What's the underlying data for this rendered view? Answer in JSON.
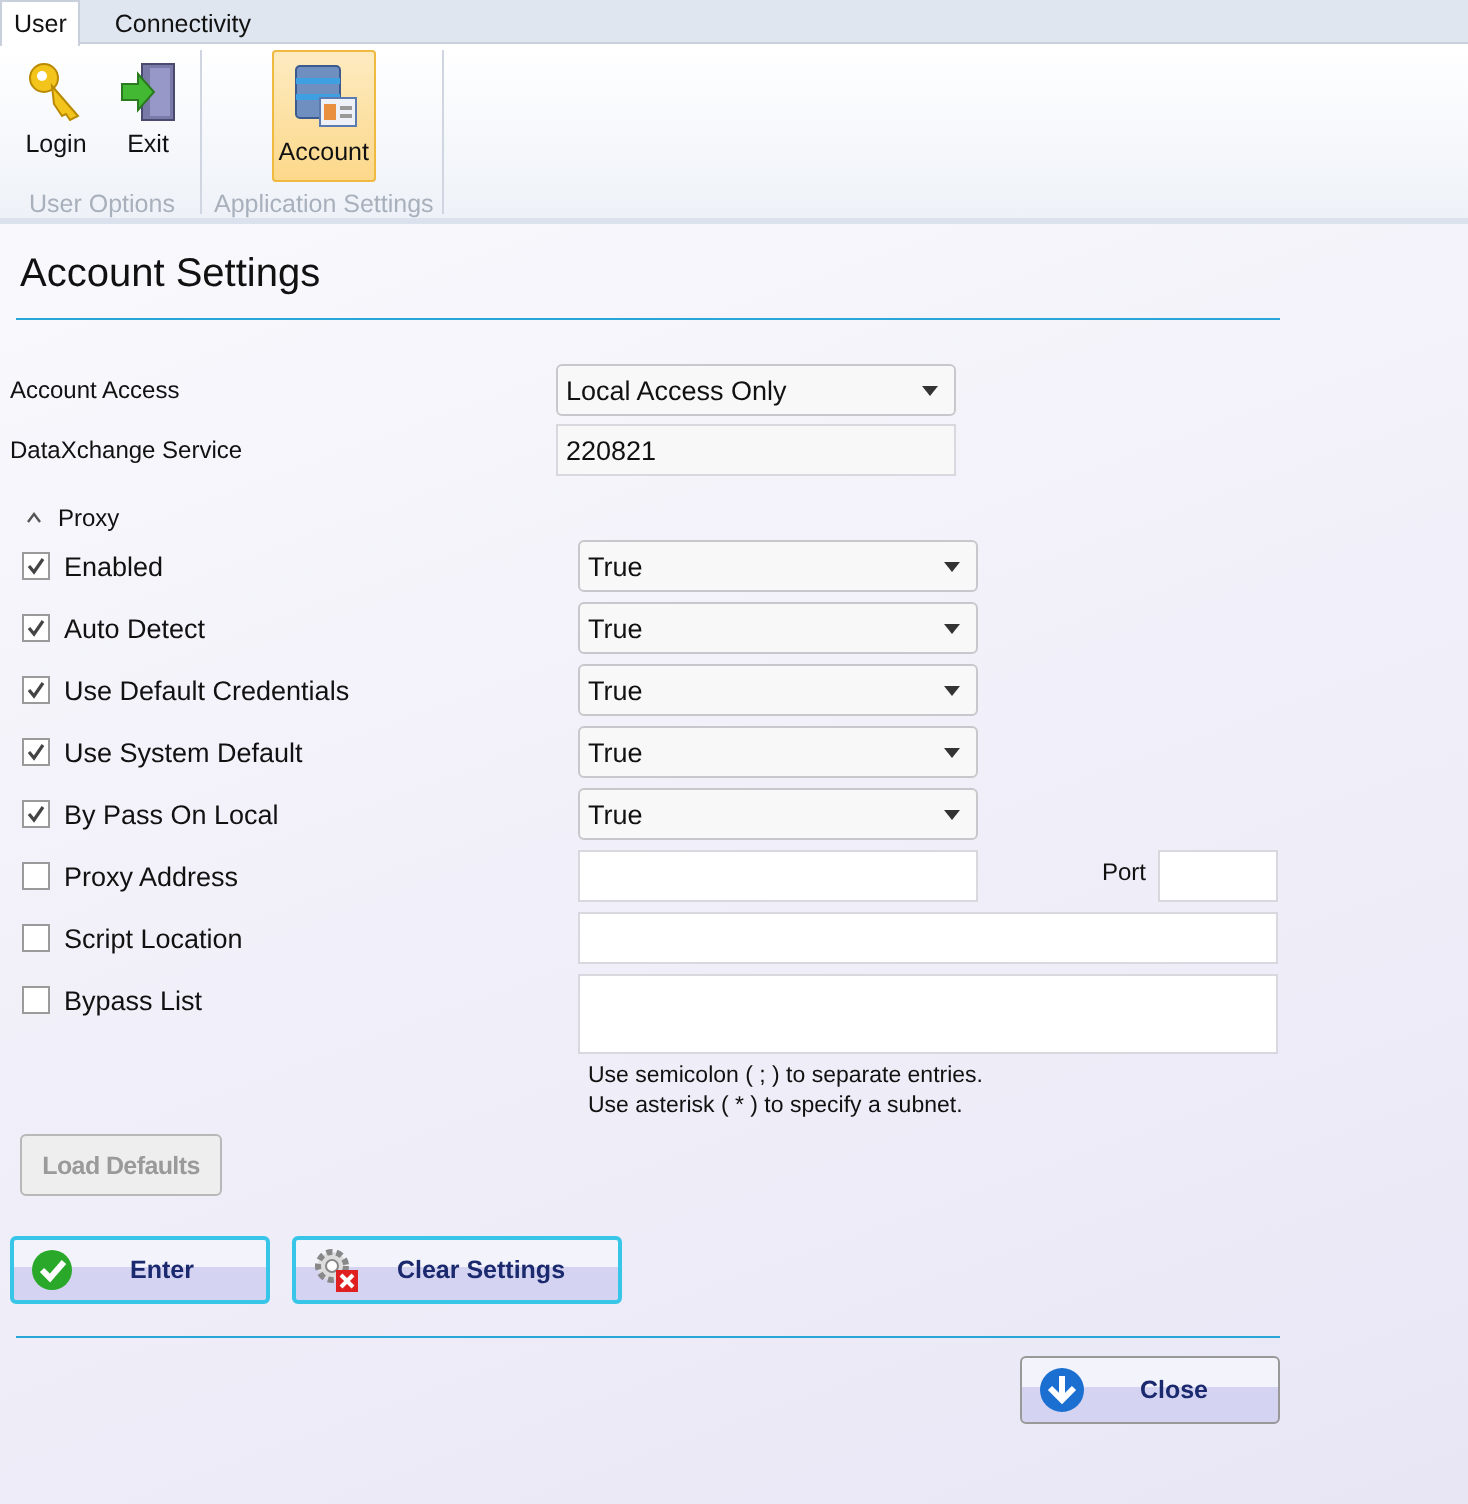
{
  "ribbon_tabs": [
    {
      "label": "User",
      "selected": true
    },
    {
      "label": "Connectivity",
      "selected": false
    }
  ],
  "ribbon_groups": [
    {
      "label": "User Options",
      "buttons": [
        {
          "label": "Login",
          "kind": "key",
          "selected": false
        },
        {
          "label": "Exit",
          "kind": "exit",
          "selected": false
        }
      ]
    },
    {
      "label": "Application Settings",
      "buttons": [
        {
          "label": "Account",
          "kind": "account",
          "selected": true
        }
      ]
    }
  ],
  "title": "Account Settings",
  "fields": [
    {
      "label": "Account Access",
      "kind": "select",
      "value": "Local Access Only"
    },
    {
      "label": "DataXchange Service",
      "kind": "text",
      "value": "220821"
    }
  ],
  "proxy": {
    "label": "Proxy",
    "expanded": true,
    "rows": [
      {
        "label": "Enabled",
        "checked": true,
        "kind": "select",
        "value": "True"
      },
      {
        "label": "Auto Detect",
        "checked": true,
        "kind": "select",
        "value": "True"
      },
      {
        "label": "Use Default Credentials",
        "checked": true,
        "kind": "select",
        "value": "True"
      },
      {
        "label": "Use System Default",
        "checked": true,
        "kind": "select",
        "value": "True"
      },
      {
        "label": "By Pass On Local",
        "checked": true,
        "kind": "select",
        "value": "True"
      },
      {
        "label": "Proxy Address",
        "checked": false,
        "kind": "address",
        "port_label": "Port"
      },
      {
        "label": "Script Location",
        "checked": false,
        "kind": "text"
      },
      {
        "label": "Bypass List",
        "checked": false,
        "kind": "textarea"
      }
    ],
    "hints": [
      "Use semicolon ( ; ) to separate entries.",
      "Use asterisk ( * ) to specify a subnet."
    ]
  },
  "load_defaults": {
    "label": "Load Defaults",
    "disabled": true
  },
  "actions": [
    {
      "label": "Enter",
      "kind": "check"
    },
    {
      "label": "Clear Settings",
      "kind": "clear"
    }
  ],
  "close": {
    "label": "Close",
    "kind": "down"
  }
}
